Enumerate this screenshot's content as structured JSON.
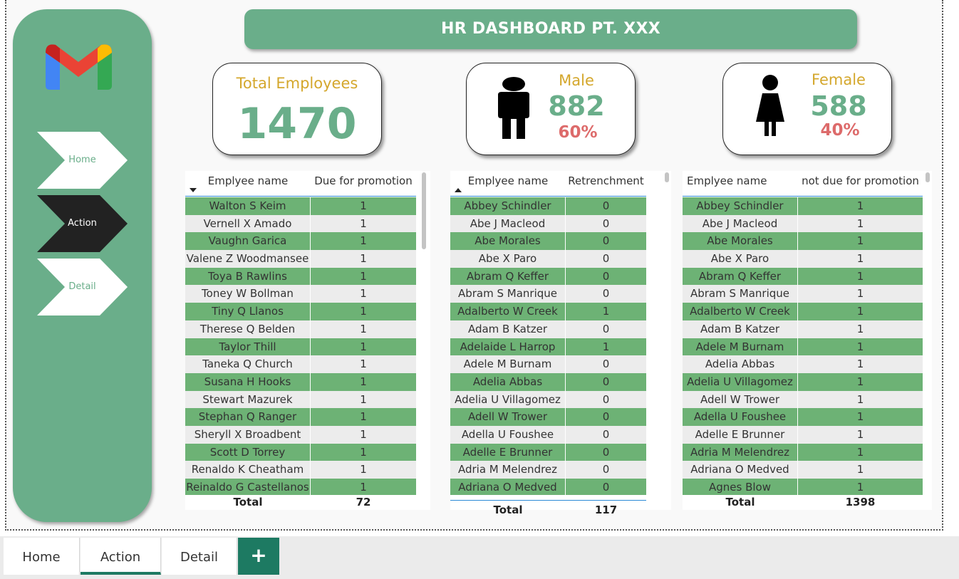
{
  "header": {
    "title": "HR DASHBOARD PT. XXX"
  },
  "nav": {
    "items": [
      {
        "label": "Home",
        "active": false
      },
      {
        "label": "Action",
        "active": true
      },
      {
        "label": "Detail",
        "active": false
      }
    ]
  },
  "kpis": {
    "total": {
      "label": "Total Employees",
      "value": "1470"
    },
    "male": {
      "label": "Male",
      "value": "882",
      "percent": "60%"
    },
    "female": {
      "label": "Female",
      "value": "588",
      "percent": "40%"
    }
  },
  "tables": {
    "promotion": {
      "columns": [
        "Emplyee name",
        "Due for promotion"
      ],
      "rows": [
        [
          "Walton S Keim",
          "1"
        ],
        [
          "Vernell X Amado",
          "1"
        ],
        [
          "Vaughn Garica",
          "1"
        ],
        [
          "Valene Z Woodmansee",
          "1"
        ],
        [
          "Toya B Rawlins",
          "1"
        ],
        [
          "Toney W Bollman",
          "1"
        ],
        [
          "Tiny Q Llanos",
          "1"
        ],
        [
          "Therese Q Belden",
          "1"
        ],
        [
          "Taylor Thill",
          "1"
        ],
        [
          "Taneka Q Church",
          "1"
        ],
        [
          "Susana H Hooks",
          "1"
        ],
        [
          "Stewart Mazurek",
          "1"
        ],
        [
          "Stephan Q Ranger",
          "1"
        ],
        [
          "Sheryll X Broadbent",
          "1"
        ],
        [
          "Scott D Torrey",
          "1"
        ],
        [
          "Renaldo K Cheatham",
          "1"
        ],
        [
          "Reinaldo G Castellanos",
          "1"
        ]
      ],
      "total_label": "Total",
      "total_value": "72"
    },
    "retrenchment": {
      "columns": [
        "Emplyee name",
        "Retrenchment"
      ],
      "rows": [
        [
          "Abbey Schindler",
          "0"
        ],
        [
          "Abe J Macleod",
          "0"
        ],
        [
          "Abe Morales",
          "0"
        ],
        [
          "Abe X Paro",
          "0"
        ],
        [
          "Abram Q Keffer",
          "0"
        ],
        [
          "Abram S Manrique",
          "0"
        ],
        [
          "Adalberto W Creek",
          "1"
        ],
        [
          "Adam B Katzer",
          "0"
        ],
        [
          "Adelaide L Harrop",
          "1"
        ],
        [
          "Adele M Burnam",
          "0"
        ],
        [
          "Adelia Abbas",
          "0"
        ],
        [
          "Adelia U Villagomez",
          "0"
        ],
        [
          "Adell W Trower",
          "0"
        ],
        [
          "Adella U Foushee",
          "0"
        ],
        [
          "Adelle E Brunner",
          "0"
        ],
        [
          "Adria M Melendrez",
          "0"
        ],
        [
          "Adriana O Medved",
          "0"
        ]
      ],
      "total_label": "Total",
      "total_value": "117"
    },
    "not_due": {
      "columns": [
        "Emplyee name",
        "not due for promotion"
      ],
      "rows": [
        [
          "Abbey Schindler",
          "1"
        ],
        [
          "Abe J Macleod",
          "1"
        ],
        [
          "Abe Morales",
          "1"
        ],
        [
          "Abe X Paro",
          "1"
        ],
        [
          "Abram Q Keffer",
          "1"
        ],
        [
          "Abram S Manrique",
          "1"
        ],
        [
          "Adalberto W Creek",
          "1"
        ],
        [
          "Adam B Katzer",
          "1"
        ],
        [
          "Adele M Burnam",
          "1"
        ],
        [
          "Adelia Abbas",
          "1"
        ],
        [
          "Adelia U Villagomez",
          "1"
        ],
        [
          "Adell W Trower",
          "1"
        ],
        [
          "Adella U Foushee",
          "1"
        ],
        [
          "Adelle E Brunner",
          "1"
        ],
        [
          "Adria M Melendrez",
          "1"
        ],
        [
          "Adriana O Medved",
          "1"
        ],
        [
          "Agnes Blow",
          "1"
        ]
      ],
      "total_label": "Total",
      "total_value": "1398"
    }
  },
  "tabs": [
    {
      "label": "Home",
      "active": false
    },
    {
      "label": "Action",
      "active": true
    },
    {
      "label": "Detail",
      "active": false
    }
  ],
  "add_tab_label": "+",
  "colors": {
    "accent_green": "#6aae8a",
    "row_green": "#6db275",
    "gold": "#d4a72c",
    "pink": "#dd6b6b",
    "tab_active": "#1d7a62"
  }
}
